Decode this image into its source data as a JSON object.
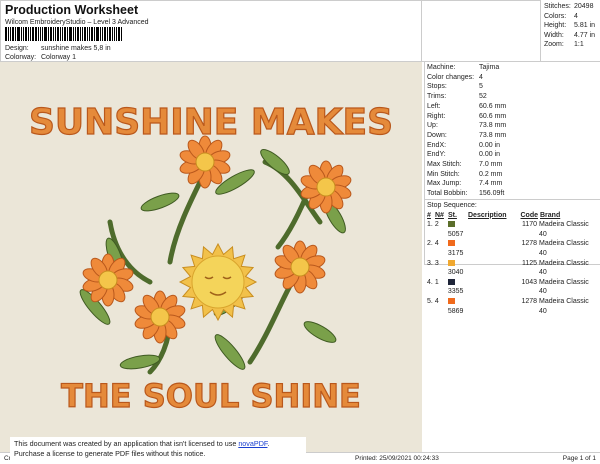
{
  "header": {
    "title": "Production Worksheet",
    "subtitle": "Wilcom EmbroideryStudio – Level 3 Advanced",
    "design_label": "Design:",
    "design_value": "sunshine makes 5,8 in",
    "colorway_label": "Colorway:",
    "colorway_value": "Colorway 1"
  },
  "stats": [
    {
      "k": "Stitches:",
      "v": "20498"
    },
    {
      "k": "Colors:",
      "v": "4"
    },
    {
      "k": "Height:",
      "v": "5.81 in"
    },
    {
      "k": "Width:",
      "v": "4.77 in"
    },
    {
      "k": "Zoom:",
      "v": "1:1"
    }
  ],
  "details": [
    {
      "k": "Machine:",
      "v": "Tajima"
    },
    {
      "k": "Color changes:",
      "v": "4"
    },
    {
      "k": "Stops:",
      "v": "5"
    },
    {
      "k": "Trims:",
      "v": "52"
    },
    {
      "k": "Left:",
      "v": "60.6 mm"
    },
    {
      "k": "Right:",
      "v": "60.6 mm"
    },
    {
      "k": "Up:",
      "v": "73.8 mm"
    },
    {
      "k": "Down:",
      "v": "73.8 mm"
    },
    {
      "k": "EndX:",
      "v": "0.00 in"
    },
    {
      "k": "EndY:",
      "v": "0.00 in"
    },
    {
      "k": "Max Stitch:",
      "v": "7.0 mm"
    },
    {
      "k": "Min Stitch:",
      "v": "0.2 mm"
    },
    {
      "k": "Max Jump:",
      "v": "7.4 mm"
    },
    {
      "k": "Total Bobbin:",
      "v": "156.09ft"
    }
  ],
  "sequence": {
    "title": "Stop Sequence:",
    "headers": [
      "#",
      "N#",
      "St.",
      "Description",
      "Code",
      "Brand"
    ],
    "rows": [
      {
        "n": "1.",
        "nn": "2",
        "color": "#5b6e2a",
        "st": "5057",
        "desc": "",
        "code": "1170",
        "brand": "Madeira Classic 40"
      },
      {
        "n": "2.",
        "nn": "4",
        "color": "#f06a1c",
        "st": "3175",
        "desc": "",
        "code": "1278",
        "brand": "Madeira Classic 40"
      },
      {
        "n": "3.",
        "nn": "3",
        "color": "#f0a830",
        "st": "3040",
        "desc": "",
        "code": "1125",
        "brand": "Madeira Classic 40"
      },
      {
        "n": "4.",
        "nn": "1",
        "color": "#1e2438",
        "st": "3355",
        "desc": "",
        "code": "1043",
        "brand": "Madeira Classic 40"
      },
      {
        "n": "5.",
        "nn": "4",
        "color": "#f06a1c",
        "st": "5869",
        "desc": "",
        "code": "1278",
        "brand": "Madeira Classic 40"
      }
    ]
  },
  "design": {
    "top_text": "SUNSHINE MAKES",
    "bottom_text": "THE SOUL SHINE"
  },
  "footer": {
    "left": "Cr",
    "printed": "Printed: 25/09/2021 00:24:33",
    "page": "Page 1 of 1"
  },
  "notice": {
    "line1": "This document was created by an application that isn't licensed to use ",
    "link": "novaPDF",
    "line1_end": ".",
    "line2": "Purchase a license to generate PDF files without this notice."
  }
}
